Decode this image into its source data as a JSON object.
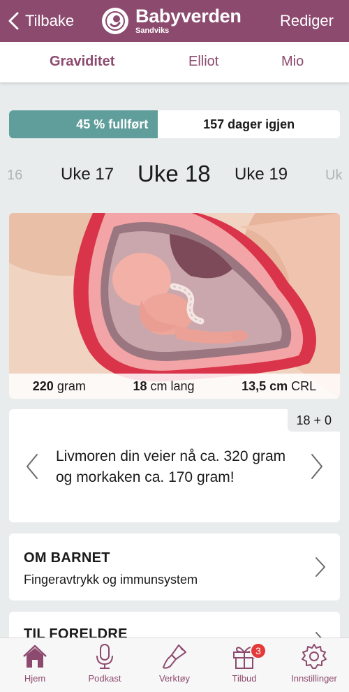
{
  "header": {
    "back_label": "Tilbake",
    "brand_name": "Babyverden",
    "brand_sub": "Sandviks",
    "edit_label": "Rediger",
    "accent_color": "#8c4a6e"
  },
  "tabs": [
    {
      "label": "Graviditet",
      "active": true
    },
    {
      "label": "Elliot",
      "active": false
    },
    {
      "label": "Mio",
      "active": false
    }
  ],
  "progress": {
    "percent": 45,
    "done_label": "45 % fullført",
    "remaining_label": "157 dager igjen",
    "fill_color": "#5f9e9a"
  },
  "weeks": {
    "prev_far": "16",
    "prev": "Uke 17",
    "current": "Uke 18",
    "next": "Uke 19",
    "next_far": "Uk"
  },
  "illustration": {
    "icon": "fetus-in-womb-illustration",
    "weight_value": "220",
    "weight_unit": "gram",
    "length_value": "18",
    "length_unit": "cm lang",
    "crl_value": "13,5 cm",
    "crl_unit": "CRL"
  },
  "fact": {
    "day": "18 + 0",
    "text": "Livmoren din veier nå ca. 320 gram og morkaken ca. 170 gram!"
  },
  "sections": [
    {
      "title": "OM BARNET",
      "subtitle": "Fingeravtrykk og immunsystem"
    },
    {
      "title": "TIL FORELDRE",
      "subtitle": ""
    }
  ],
  "bottom_nav": [
    {
      "label": "Hjem",
      "icon": "home-icon",
      "active": true
    },
    {
      "label": "Podkast",
      "icon": "microphone-icon",
      "active": false
    },
    {
      "label": "Verktøy",
      "icon": "brush-icon",
      "active": false
    },
    {
      "label": "Tilbud",
      "icon": "gift-icon",
      "active": false,
      "badge": "3"
    },
    {
      "label": "Innstillinger",
      "icon": "gear-icon",
      "active": false
    }
  ]
}
